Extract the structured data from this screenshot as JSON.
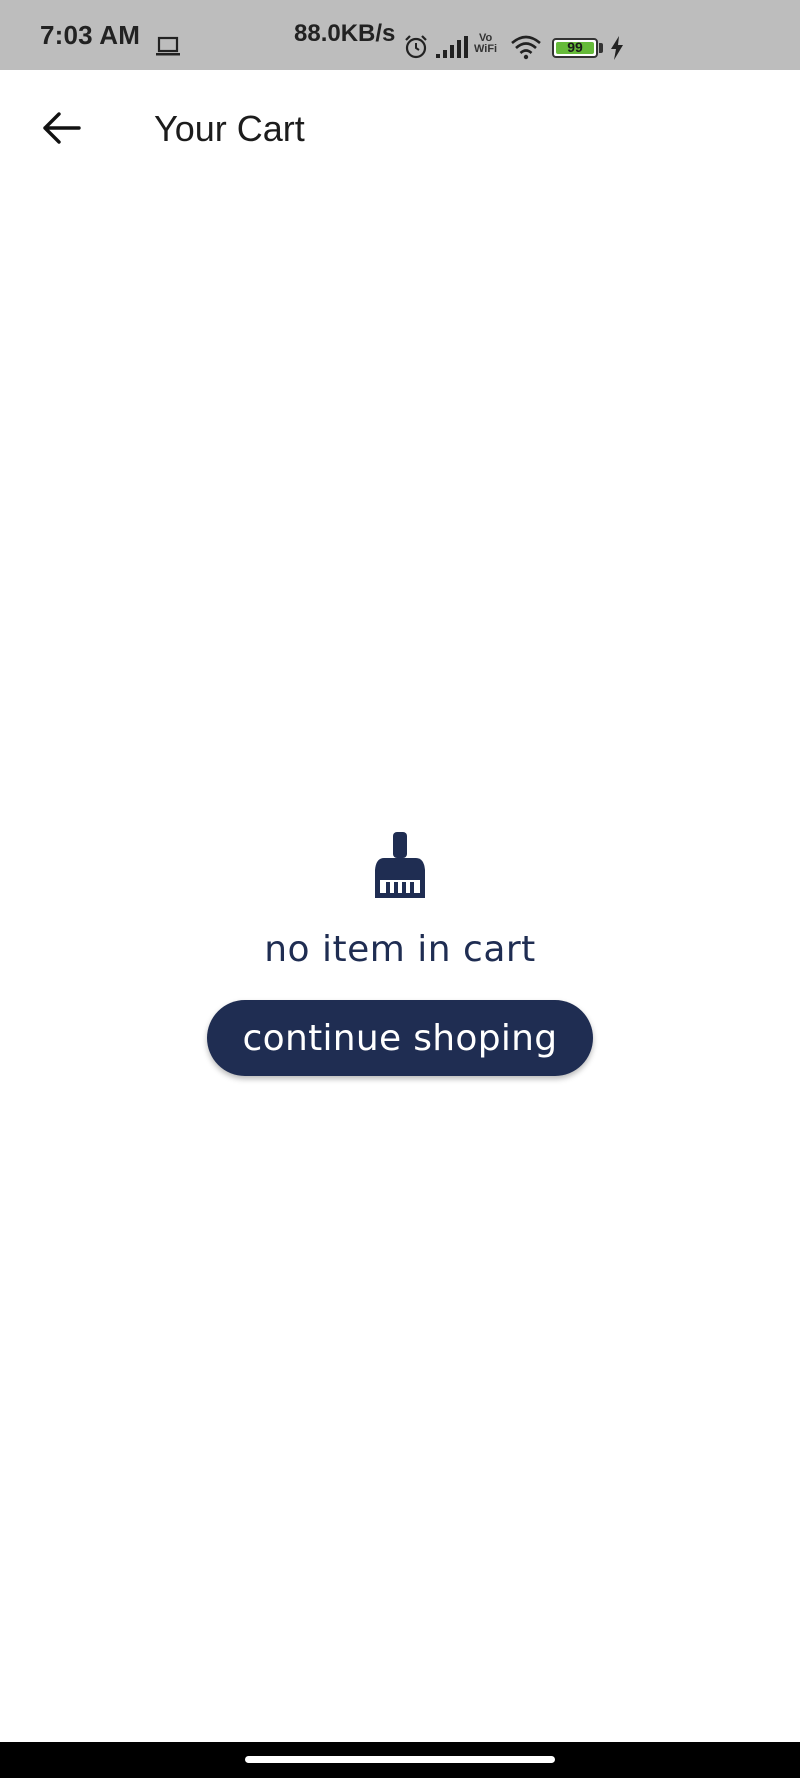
{
  "status_bar": {
    "time": "7:03 AM",
    "net_speed": "88.0KB/s",
    "vowifi_top": "Vo",
    "vowifi_bottom": "WiFi",
    "battery_level": "99",
    "icons": [
      "laptop-icon",
      "alarm-icon",
      "signal-icon",
      "vowifi-icon",
      "wifi-icon",
      "battery-icon",
      "charging-bolt-icon"
    ],
    "battery_color": "#66bb3a"
  },
  "app_bar": {
    "back_icon": "arrow-left-icon",
    "title": "Your Cart"
  },
  "empty_state": {
    "icon": "broom-icon",
    "message": "no item in cart",
    "button_label": "continue shoping",
    "accent_color": "#1f2d52"
  }
}
